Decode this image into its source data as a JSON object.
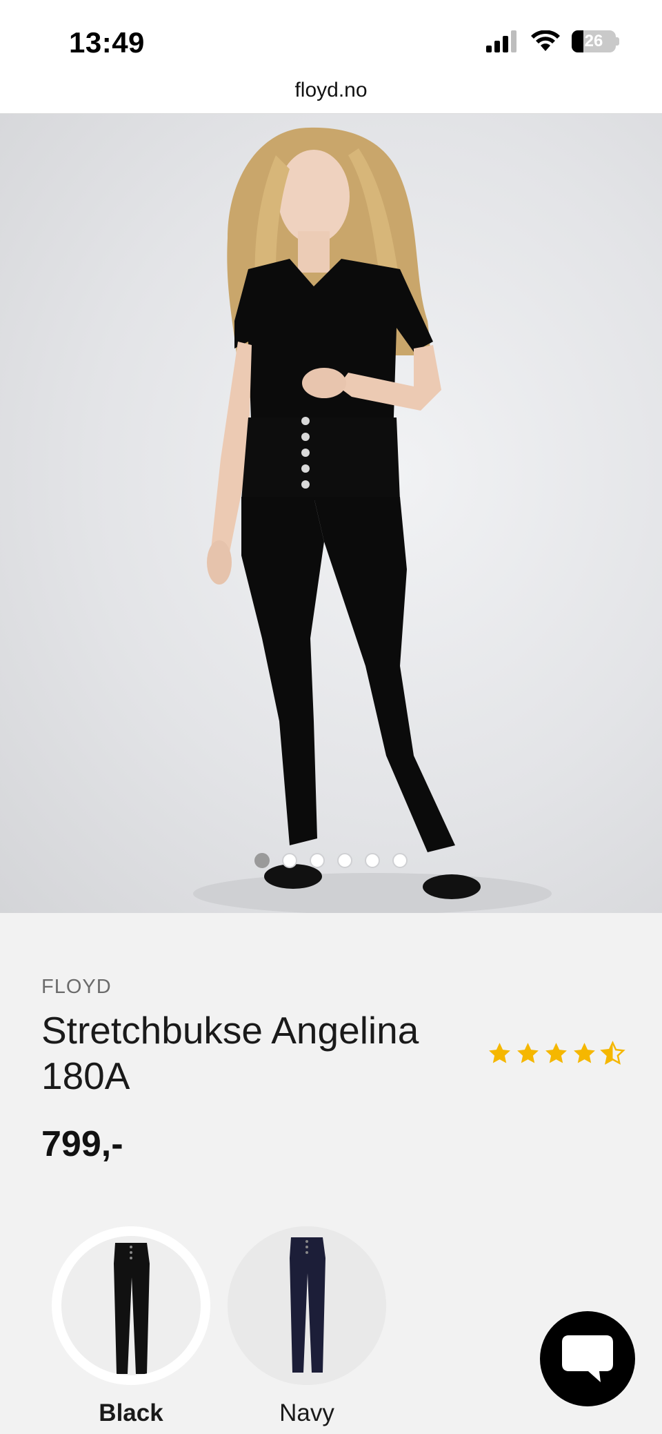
{
  "status_bar": {
    "time": "13:49",
    "battery": "26",
    "icons": [
      "signal-icon",
      "wifi-icon",
      "battery-icon"
    ]
  },
  "browser": {
    "url": "floyd.no"
  },
  "gallery": {
    "image_count": 6,
    "active_index": 0
  },
  "product": {
    "brand": "FLOYD",
    "title": "Stretchbukse Angelina 180A",
    "price": "799,-",
    "rating": 4.5,
    "rating_max": 5
  },
  "colors": {
    "selected": "Black",
    "options": [
      {
        "label": "Black",
        "swatch_color": "#111111"
      },
      {
        "label": "Navy",
        "swatch_color": "#1c1e38"
      }
    ],
    "accent_star": "#f5b700"
  },
  "chat": {
    "icon": "chat-bubble-icon"
  }
}
